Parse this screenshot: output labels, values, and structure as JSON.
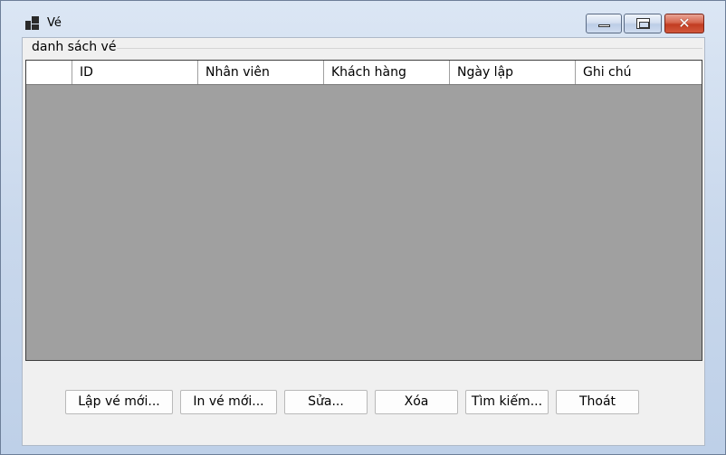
{
  "window": {
    "title": "Vé",
    "icon": "app-icon",
    "controls": {
      "minimize": "minimize-icon",
      "maximize": "maximize-icon",
      "close": "close-icon"
    }
  },
  "group": {
    "label": "danh sách vé"
  },
  "grid": {
    "columns": [
      "",
      "ID",
      "Nhân viên",
      "Khách hàng",
      "Ngày lập",
      "Ghi chú"
    ],
    "rows": []
  },
  "buttons": {
    "create": "Lập vé mới...",
    "print": "In vé mới...",
    "edit": "Sửa...",
    "delete": "Xóa",
    "search": "Tìm kiếm...",
    "exit": "Thoát"
  },
  "colors": {
    "grid_background": "#a0a0a0",
    "close_button": "#c94a30",
    "title_bar": "#c9d8ec"
  }
}
